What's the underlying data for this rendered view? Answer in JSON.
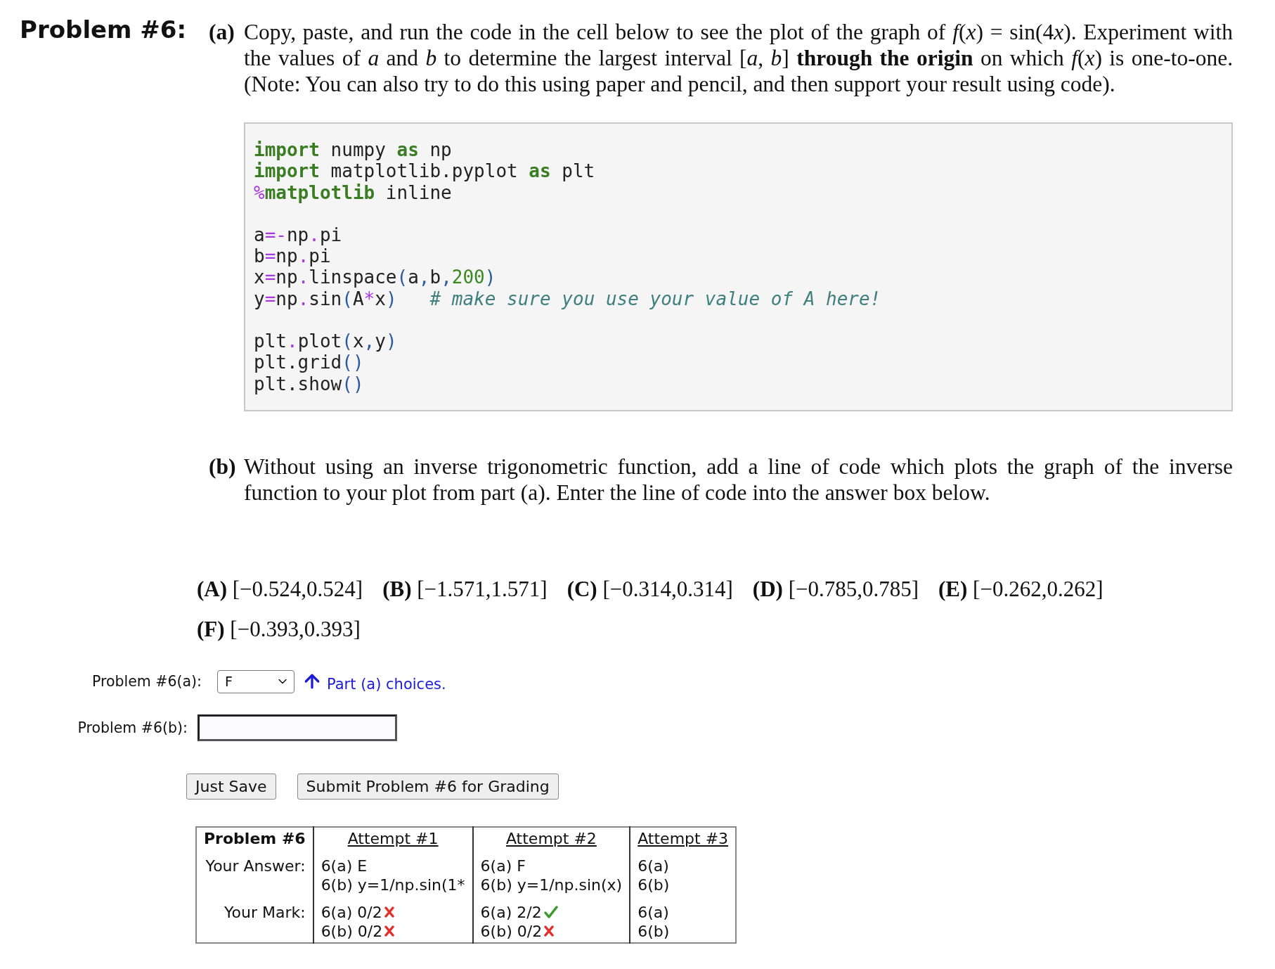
{
  "problem": {
    "title": "Problem #6:"
  },
  "part_a": {
    "label": "(a)",
    "text": [
      {
        "kind": "plain",
        "text": "Copy, paste, and run the code in the cell below to see the plot of the graph of "
      },
      {
        "kind": "math",
        "text": "f"
      },
      {
        "kind": "plain",
        "text": "("
      },
      {
        "kind": "math",
        "text": "x"
      },
      {
        "kind": "plain",
        "text": ") = sin(4"
      },
      {
        "kind": "math",
        "text": "x"
      },
      {
        "kind": "plain",
        "text": "). Experiment with the values of "
      },
      {
        "kind": "math",
        "text": "a"
      },
      {
        "kind": "plain",
        "text": " and "
      },
      {
        "kind": "math",
        "text": "b"
      },
      {
        "kind": "plain",
        "text": " to determine the largest interval ["
      },
      {
        "kind": "math",
        "text": "a"
      },
      {
        "kind": "plain",
        "text": ", "
      },
      {
        "kind": "math",
        "text": "b"
      },
      {
        "kind": "plain",
        "text": "] "
      },
      {
        "kind": "bold",
        "text": "through the origin"
      },
      {
        "kind": "plain",
        "text": " on which "
      },
      {
        "kind": "math",
        "text": "f"
      },
      {
        "kind": "plain",
        "text": "("
      },
      {
        "kind": "math",
        "text": "x"
      },
      {
        "kind": "plain",
        "text": ") is one-to-one. (Note: You can also try to do this using paper and pencil, and then support your result using code)."
      }
    ]
  },
  "code_blocks": [
    [
      [
        {
          "kind": "keyword",
          "text": "import"
        },
        {
          "kind": "plain",
          "text": " numpy "
        },
        {
          "kind": "keyword",
          "text": "as"
        },
        {
          "kind": "plain",
          "text": " np"
        }
      ],
      [
        {
          "kind": "keyword",
          "text": "import"
        },
        {
          "kind": "plain",
          "text": " matplotlib.pyplot "
        },
        {
          "kind": "keyword",
          "text": "as"
        },
        {
          "kind": "plain",
          "text": " plt"
        }
      ],
      [
        {
          "kind": "op",
          "text": "%"
        },
        {
          "kind": "keyword",
          "text": "matplotlib"
        },
        {
          "kind": "plain",
          "text": " inline"
        }
      ]
    ],
    [
      [
        {
          "kind": "plain",
          "text": "a"
        },
        {
          "kind": "op",
          "text": "=-"
        },
        {
          "kind": "plain",
          "text": "np"
        },
        {
          "kind": "op",
          "text": "."
        },
        {
          "kind": "plain",
          "text": "pi"
        }
      ],
      [
        {
          "kind": "plain",
          "text": "b"
        },
        {
          "kind": "op",
          "text": "="
        },
        {
          "kind": "plain",
          "text": "np"
        },
        {
          "kind": "op",
          "text": "."
        },
        {
          "kind": "plain",
          "text": "pi"
        }
      ],
      [
        {
          "kind": "plain",
          "text": "x"
        },
        {
          "kind": "op",
          "text": "="
        },
        {
          "kind": "plain",
          "text": "np"
        },
        {
          "kind": "op",
          "text": "."
        },
        {
          "kind": "plain",
          "text": "linspace"
        },
        {
          "kind": "paren",
          "text": "("
        },
        {
          "kind": "plain",
          "text": "a"
        },
        {
          "kind": "paren",
          "text": ","
        },
        {
          "kind": "plain",
          "text": "b"
        },
        {
          "kind": "paren",
          "text": ","
        },
        {
          "kind": "number",
          "text": "200"
        },
        {
          "kind": "paren",
          "text": ")"
        }
      ],
      [
        {
          "kind": "plain",
          "text": "y"
        },
        {
          "kind": "op",
          "text": "="
        },
        {
          "kind": "plain",
          "text": "np"
        },
        {
          "kind": "op",
          "text": "."
        },
        {
          "kind": "plain",
          "text": "sin"
        },
        {
          "kind": "paren",
          "text": "("
        },
        {
          "kind": "plain",
          "text": "A"
        },
        {
          "kind": "op",
          "text": "*"
        },
        {
          "kind": "plain",
          "text": "x"
        },
        {
          "kind": "paren",
          "text": ")"
        },
        {
          "kind": "comment",
          "text": "   # make sure you use your value of A here!"
        }
      ]
    ],
    [
      [
        {
          "kind": "plain",
          "text": "plt"
        },
        {
          "kind": "op",
          "text": "."
        },
        {
          "kind": "plain",
          "text": "plot"
        },
        {
          "kind": "paren",
          "text": "("
        },
        {
          "kind": "plain",
          "text": "x"
        },
        {
          "kind": "paren",
          "text": ","
        },
        {
          "kind": "plain",
          "text": "y"
        },
        {
          "kind": "paren",
          "text": ")"
        }
      ],
      [
        {
          "kind": "plain",
          "text": "plt.grid"
        },
        {
          "kind": "paren",
          "text": "()"
        }
      ],
      [
        {
          "kind": "plain",
          "text": "plt.show"
        },
        {
          "kind": "paren",
          "text": "()"
        }
      ]
    ]
  ],
  "part_b": {
    "label": "(b)",
    "text": "Without using an inverse trigonometric function, add a line of code which plots the graph of the inverse function to your plot from part (a). Enter the line of code into the answer box below."
  },
  "choices": [
    {
      "letter": "(A)",
      "interval": "[−0.524,0.524]"
    },
    {
      "letter": "(B)",
      "interval": "[−1.571,1.571]"
    },
    {
      "letter": "(C)",
      "interval": "[−0.314,0.314]"
    },
    {
      "letter": "(D)",
      "interval": "[−0.785,0.785]"
    },
    {
      "letter": "(E)",
      "interval": "[−0.262,0.262]"
    },
    {
      "letter": "(F)",
      "interval": "[−0.393,0.393]"
    }
  ],
  "answer_a": {
    "label": "Problem #6(a):",
    "value": "F",
    "link": "Part (a) choices."
  },
  "answer_b": {
    "label": "Problem #6(b):"
  },
  "buttons": [
    "Just Save",
    "Submit Problem #6 for Grading"
  ],
  "attempts_table": {
    "header": "Problem #6",
    "columns": [
      "Attempt #1",
      "Attempt #2",
      "Attempt #3"
    ],
    "rows": [
      {
        "label": "Your Answer:",
        "cells": [
          [
            {
              "text": "6(a) E"
            },
            {
              "text": "6(b) y=1/np.sin(1*"
            }
          ],
          [
            {
              "text": "6(a) F"
            },
            {
              "text": "6(b) y=1/np.sin(x)"
            }
          ],
          [
            {
              "text": "6(a)"
            },
            {
              "text": "6(b)"
            }
          ]
        ]
      },
      {
        "label": "Your Mark:",
        "cells": [
          [
            {
              "text": "6(a) 0/2",
              "correct": false
            },
            {
              "text": "6(b) 0/2",
              "correct": false
            }
          ],
          [
            {
              "text": "6(a) 2/2",
              "correct": true
            },
            {
              "text": "6(b) 0/2",
              "correct": false
            }
          ],
          [
            {
              "text": "6(a)"
            },
            {
              "text": "6(b)"
            }
          ]
        ]
      }
    ]
  }
}
